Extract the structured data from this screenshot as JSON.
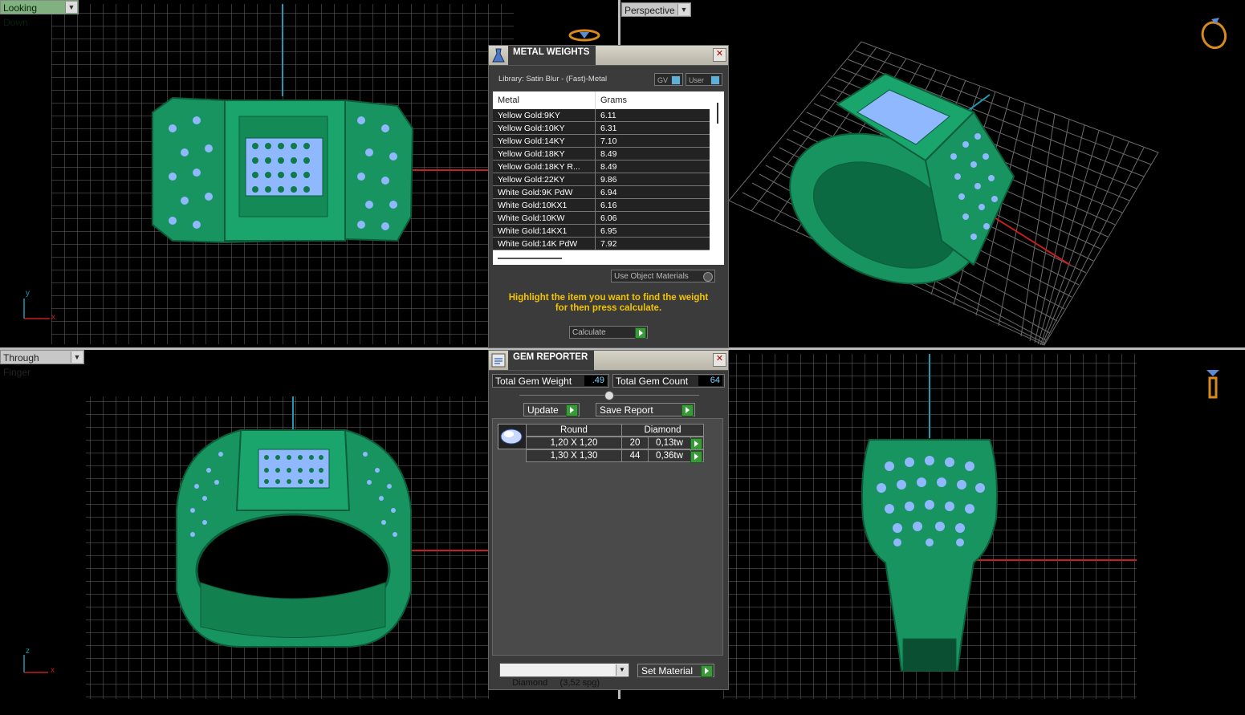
{
  "viewports": {
    "top_left": {
      "label": "Looking Down"
    },
    "top_right": {
      "label": "Perspective"
    },
    "bottom_left": {
      "label": "Through Finger"
    },
    "bottom_right": {
      "label": ""
    }
  },
  "axes": {
    "x": "x",
    "y": "y",
    "z": "z"
  },
  "metal_weights": {
    "title": "METAL WEIGHTS",
    "close": "✕",
    "library": "Library: Satin Blur - (Fast)-Metal",
    "toggle_gv": "GV",
    "toggle_user": "User",
    "columns": [
      "Metal",
      "Grams"
    ],
    "rows": [
      {
        "metal": "Yellow Gold:9KY",
        "grams": "6.11"
      },
      {
        "metal": "Yellow Gold:10KY",
        "grams": "6.31"
      },
      {
        "metal": "Yellow Gold:14KY",
        "grams": "7.10"
      },
      {
        "metal": "Yellow Gold:18KY",
        "grams": "8.49"
      },
      {
        "metal": "Yellow Gold:18KY R...",
        "grams": "8.49"
      },
      {
        "metal": "Yellow Gold:22KY",
        "grams": "9.86"
      },
      {
        "metal": "White Gold:9K PdW",
        "grams": "6.94"
      },
      {
        "metal": "White Gold:10KX1",
        "grams": "6.16"
      },
      {
        "metal": "White Gold:10KW",
        "grams": "6.06"
      },
      {
        "metal": "White Gold:14KX1",
        "grams": "6.95"
      },
      {
        "metal": "White Gold:14K PdW",
        "grams": "7.92"
      }
    ],
    "use_object_materials": "Use Object Materials",
    "hint_line1": "Highlight the item you want to find the weight",
    "hint_line2": "for then press calculate.",
    "calculate": "Calculate"
  },
  "gem_reporter": {
    "title": "GEM REPORTER",
    "close": "✕",
    "total_weight_label": "Total Gem Weight",
    "total_weight_value": ".49",
    "total_count_label": "Total Gem Count",
    "total_count_value": "64",
    "update": "Update",
    "save_report": "Save Report",
    "shape": "Round",
    "stone": "Diamond",
    "rows": [
      {
        "size": "1,20 X 1,20",
        "count": "20",
        "weight": "0,13tw"
      },
      {
        "size": "1,30 X 1,30",
        "count": "44",
        "weight": "0,36tw"
      }
    ],
    "material": "Diamond     (3,52 spg)",
    "set_material": "Set Material"
  },
  "colors": {
    "ring": "#1a9e6a",
    "gem": "#8fb8ff",
    "grid": "#6e6e6e",
    "x_axis": "#c81e1e",
    "y_axis": "#1e9ab4"
  }
}
